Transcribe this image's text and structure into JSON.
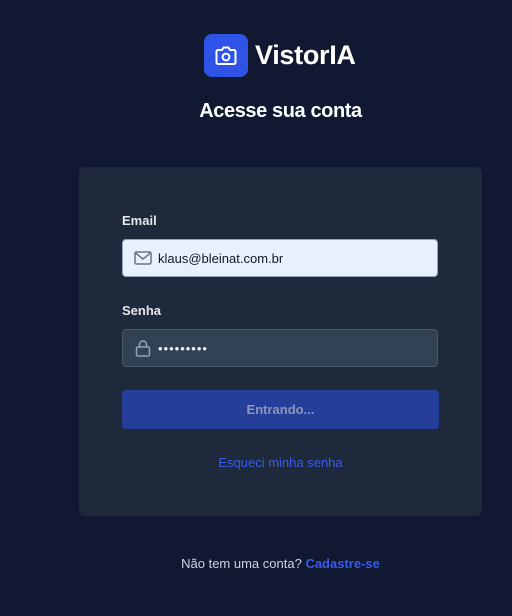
{
  "brand": {
    "name": "VistorIA",
    "logo_icon": "camera-icon",
    "accent_color": "#2f53e6"
  },
  "page": {
    "title": "Acesse sua conta"
  },
  "form": {
    "email_label": "Email",
    "email_icon": "envelope-icon",
    "email_value": "klaus@bleinat.com.br",
    "password_label": "Senha",
    "password_icon": "lock-icon",
    "password_value": "•••••••••",
    "submit_label": "Entrando...",
    "forgot_label": "Esqueci minha senha"
  },
  "footer": {
    "prompt": "Não tem uma conta?",
    "signup_label": "Cadastre-se"
  }
}
